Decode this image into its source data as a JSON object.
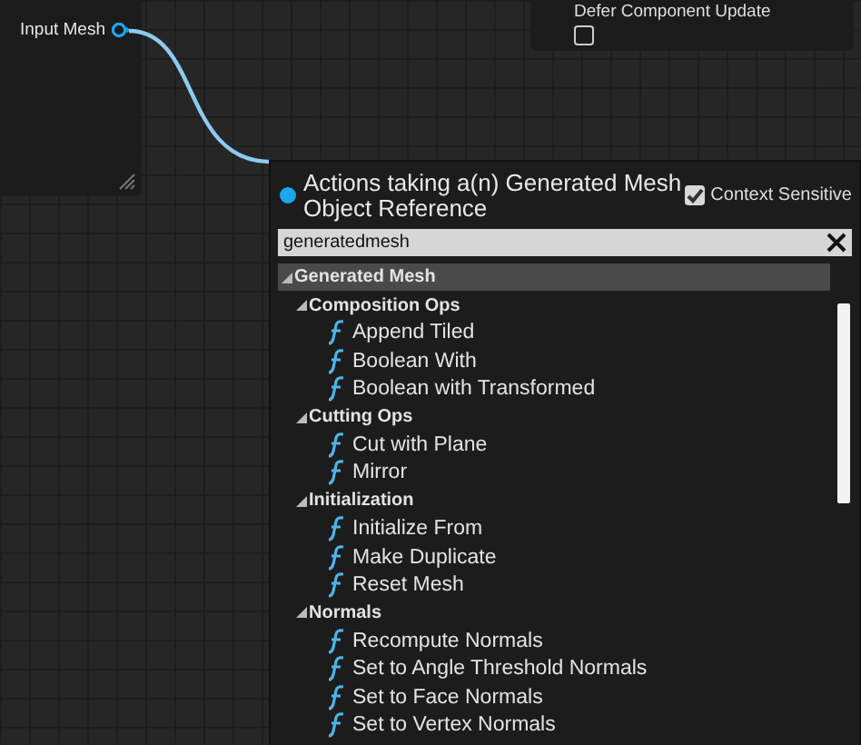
{
  "left_node": {
    "pin_label": "Input Mesh",
    "pin_connected": true
  },
  "top_node": {
    "option": {
      "label": "Defer Component Update",
      "checked": false
    }
  },
  "action_menu": {
    "title": "Actions taking a(n) Generated Mesh Object Reference",
    "context_sensitive": {
      "label": "Context Sensitive",
      "checked": true
    },
    "search": {
      "value": "generatedmesh"
    },
    "tree": [
      {
        "label": "Generated Mesh",
        "expanded": true,
        "children": [
          {
            "label": "Composition Ops",
            "expanded": true,
            "children": [
              {
                "label": "Append Tiled"
              },
              {
                "label": "Boolean With"
              },
              {
                "label": "Boolean with Transformed"
              }
            ]
          },
          {
            "label": "Cutting Ops",
            "expanded": true,
            "children": [
              {
                "label": "Cut with Plane"
              },
              {
                "label": "Mirror"
              }
            ]
          },
          {
            "label": "Initialization",
            "expanded": true,
            "children": [
              {
                "label": "Initialize From"
              },
              {
                "label": "Make Duplicate"
              },
              {
                "label": "Reset Mesh"
              }
            ]
          },
          {
            "label": "Normals",
            "expanded": true,
            "children": [
              {
                "label": "Recompute Normals"
              },
              {
                "label": "Set to Angle Threshold Normals"
              },
              {
                "label": "Set to Face Normals"
              },
              {
                "label": "Set to Vertex Normals"
              }
            ]
          }
        ]
      }
    ]
  }
}
